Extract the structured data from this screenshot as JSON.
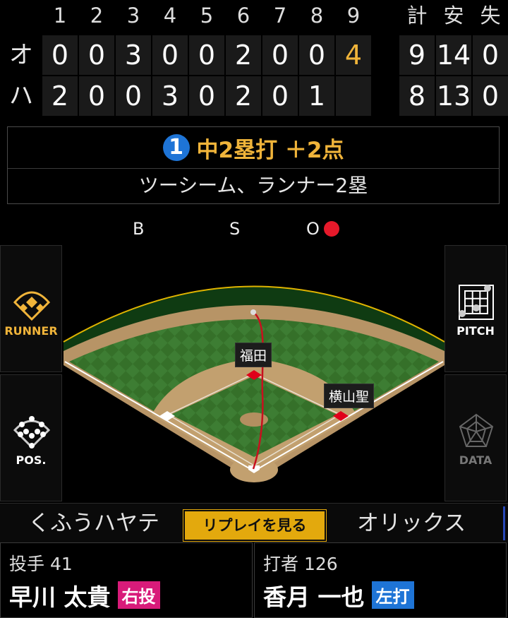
{
  "scoreboard": {
    "innings": [
      "1",
      "2",
      "3",
      "4",
      "5",
      "6",
      "7",
      "8",
      "9"
    ],
    "totals_headers": [
      "計",
      "安",
      "失"
    ],
    "teams": [
      {
        "abbr": "オ",
        "innings": [
          "0",
          "0",
          "3",
          "0",
          "0",
          "2",
          "0",
          "0",
          "4"
        ],
        "totals": [
          "9",
          "14",
          "0"
        ]
      },
      {
        "abbr": "ハ",
        "innings": [
          "2",
          "0",
          "0",
          "3",
          "0",
          "2",
          "0",
          "1",
          ""
        ],
        "totals": [
          "8",
          "13",
          "0"
        ]
      }
    ],
    "highlight_color": "#f0b43a"
  },
  "play": {
    "number": "1",
    "result": "中2塁打 ＋2点",
    "detail": "ツーシーム、ランナー2塁"
  },
  "count": {
    "balls_label": "B",
    "strikes_label": "S",
    "outs_label": "O",
    "outs": 1
  },
  "field": {
    "runner_label": "RUNNER",
    "pos_label": "POS.",
    "pitch_label": "PITCH",
    "data_label": "DATA",
    "fielders": [
      "福田",
      "横山聖"
    ]
  },
  "bottom": {
    "away_team": "くふうハヤテ",
    "replay_label": "リプレイを見る",
    "home_team": "オリックス",
    "pitcher": {
      "role": "投手 41",
      "name": "早川 太貴",
      "hand": "右投",
      "hand_color": "#d81b7a"
    },
    "batter": {
      "role": "打者 126",
      "name": "香月 一也",
      "hand": "左打",
      "hand_color": "#1e74d6"
    }
  }
}
